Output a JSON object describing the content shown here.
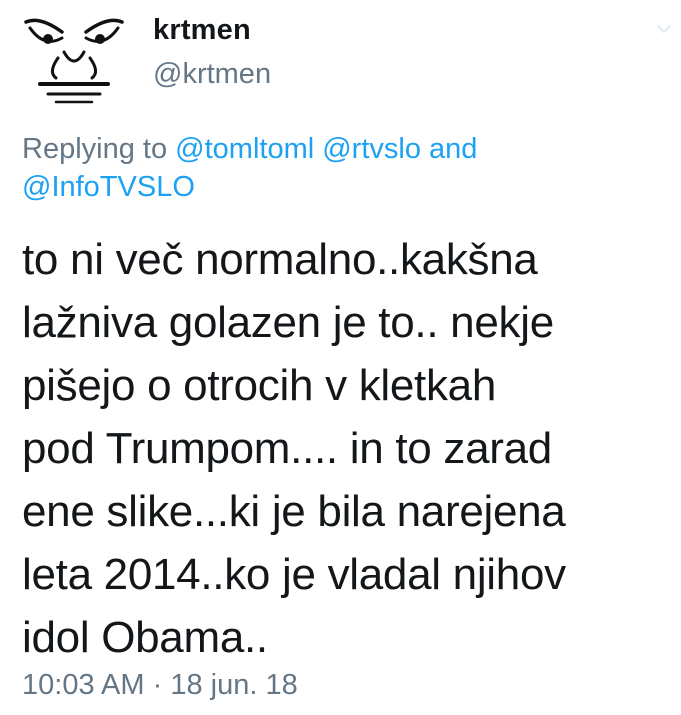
{
  "tweet": {
    "author": {
      "display_name": "krtmen",
      "handle": "@krtmen",
      "avatar_icon": "angry-face-drawing-icon"
    },
    "reply": {
      "prefix": "Replying to",
      "mentions": [
        "@tomltoml",
        "@rtvslo",
        "@InfoTVSLO"
      ],
      "conjunction": "and"
    },
    "text_lines": [
      "to ni več normalno..kakšna",
      "lažniva golazen je to.. nekje",
      "pišejo o otrocih v kletkah",
      "pod Trumpom.... in to zarad",
      "ene slike...ki je bila narejena",
      "leta 2014..ko je vladal njihov",
      "idol Obama.."
    ],
    "time": "10:03 AM",
    "separator": "·",
    "date": "18 jun. 18"
  },
  "colors": {
    "text": "#14171a",
    "secondary": "#657786",
    "link": "#1da1f2"
  }
}
